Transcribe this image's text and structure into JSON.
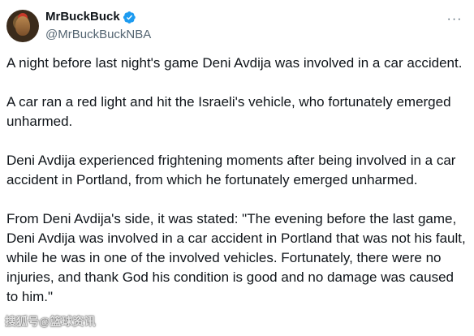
{
  "author": {
    "display_name": "MrBuckBuck",
    "handle": "@MrBuckBuckNBA",
    "verified": true,
    "avatar_icon": "rooster-avatar"
  },
  "menu": {
    "more_label": "···"
  },
  "tweet": {
    "paragraphs": [
      "A night before last night's game Deni Avdija was involved in a car accident.",
      "A car ran a red light and hit the Israeli's vehicle, who fortunately emerged unharmed.",
      "Deni Avdija experienced frightening moments after being involved in a car accident in Portland, from which he fortunately emerged unharmed.",
      "From Deni Avdija's side, it was stated: \"The evening before the last game, Deni Avdija was involved in a car accident in Portland that was not his fault, while he was in one of the involved vehicles. Fortunately, there were no injuries, and thank God his condition is good and no damage was caused to him.\""
    ]
  },
  "watermark": "搜狐号@篮球资讯",
  "colors": {
    "text": "#0f1419",
    "secondary": "#536471",
    "verified_blue": "#1d9bf0"
  }
}
